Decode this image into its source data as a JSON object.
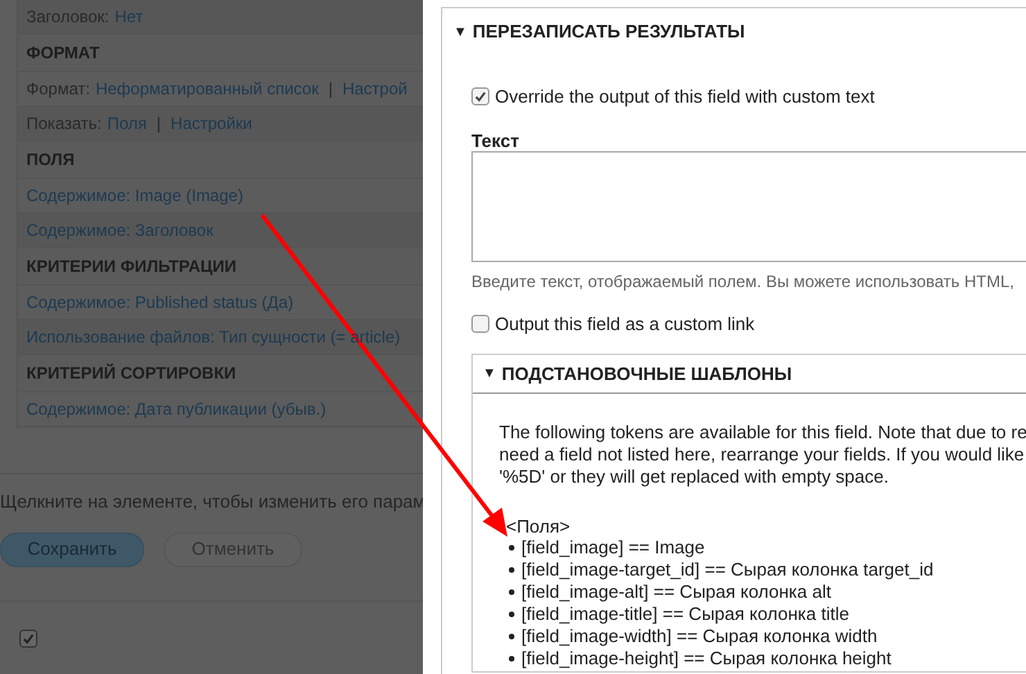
{
  "background_page": {
    "sections": [
      {
        "rows": [
          {
            "label": "Заголовок:",
            "links": [
              "Нет"
            ]
          }
        ]
      },
      {
        "heading": "ФОРМАТ",
        "rows": [
          {
            "label": "Формат:",
            "links": [
              "Неформатированный список",
              "Настрой"
            ],
            "separator": "|"
          },
          {
            "label": "Показать:",
            "links": [
              "Поля",
              "Настройки"
            ],
            "separator": "|"
          }
        ]
      },
      {
        "heading": "ПОЛЯ",
        "rows": [
          {
            "links": [
              "Содержимое: Image (Image)"
            ]
          },
          {
            "links": [
              "Содержимое: Заголовок"
            ]
          }
        ]
      },
      {
        "heading": "КРИТЕРИИ ФИЛЬТРАЦИИ",
        "rows": [
          {
            "links": [
              "Содержимое: Published status (Да)"
            ]
          },
          {
            "links": [
              "Использование файлов: Тип сущности (= article)"
            ]
          }
        ]
      },
      {
        "heading": "КРИТЕРИЙ СОРТИРОВКИ",
        "rows": [
          {
            "links": [
              "Содержимое: Дата публикации (убыв.)"
            ]
          }
        ]
      }
    ],
    "hint": "Щелкните на элементе, чтобы изменить его парам",
    "buttons": [
      {
        "label": "Сохранить",
        "kind": "primary"
      },
      {
        "label": "Отменить",
        "kind": "secondary"
      }
    ],
    "bottom_checkbox": {
      "checked": true
    }
  },
  "dialog": {
    "section": {
      "title": "ПЕРЕЗАПИСАТЬ РЕЗУЛЬТАТЫ",
      "expanded": true,
      "toggle": "▼",
      "override_checkbox": {
        "label": "Override the output of this field with custom text",
        "checked": true
      },
      "text_field": {
        "label": "Текст",
        "description": "Введите текст, отображаемый полем. Вы можете использовать HTML,"
      },
      "link_checkbox": {
        "label": "Output this field as a custom link",
        "checked": false
      },
      "tokens": {
        "title": "ПОДСТАНОВОЧНЫЕ ШАБЛОНЫ",
        "expanded": true,
        "toggle": "▼",
        "intro_lines": [
          "The following tokens are available for this field. Note that due to re",
          "need a field not listed here, rearrange your fields. If you would like",
          "'%5D' or they will get replaced with empty space."
        ],
        "group": "<Поля>",
        "items": [
          "[field_image] == Image",
          "[field_image-target_id] == Сырая колонка target_id",
          "[field_image-alt] == Сырая колонка alt",
          "[field_image-title] == Сырая колонка title",
          "[field_image-width] == Сырая колонка width",
          "[field_image-height] == Сырая колонка height"
        ]
      }
    }
  }
}
